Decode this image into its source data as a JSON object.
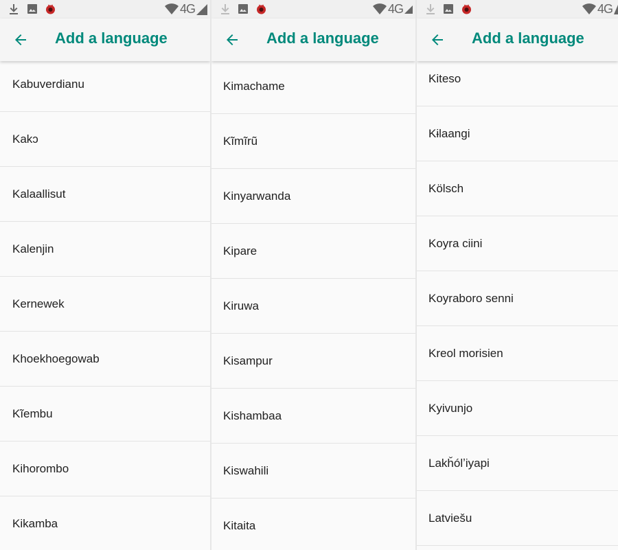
{
  "accent_color": "#00897b",
  "status_bar": {
    "network": "4G"
  },
  "panels": [
    {
      "title": "Add a language",
      "items": [
        "Kabuverdianu",
        "Kakɔ",
        "Kalaallisut",
        "Kalenjin",
        "Kernewek",
        "Khoekhoegowab",
        "Kĩembu",
        "Kihorombo",
        "Kikamba"
      ]
    },
    {
      "title": "Add a language",
      "items": [
        "Kimachame",
        "Kĩmĩrũ",
        "Kinyarwanda",
        "Kipare",
        "Kiruwa",
        "Kisampur",
        "Kishambaa",
        "Kiswahili",
        "Kitaita"
      ]
    },
    {
      "title": "Add a language",
      "items": [
        "Kiteso",
        "Kɨlaangi",
        "Kölsch",
        "Koyra ciini",
        "Koyraboro senni",
        "Kreol morisien",
        "Kyivunjo",
        "Lakȟólʼiyapi",
        "Latviešu"
      ]
    }
  ]
}
